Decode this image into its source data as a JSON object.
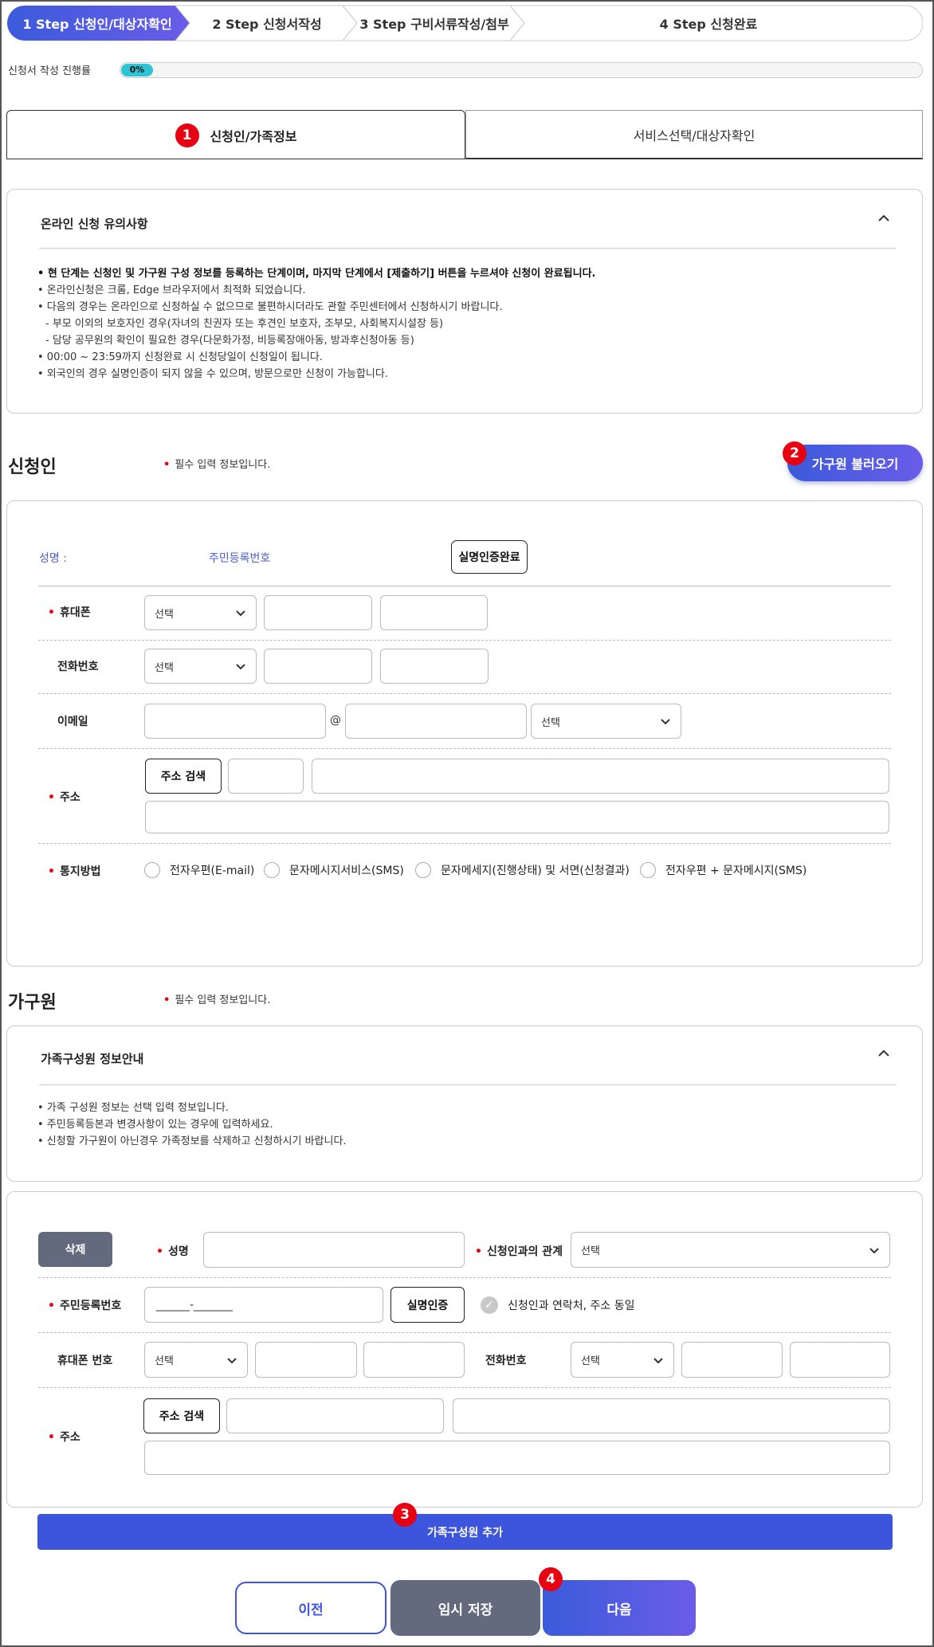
{
  "steps": [
    {
      "label": "1 Step 신청인/대상자확인",
      "active": true
    },
    {
      "label": "2 Step 신청서작성",
      "active": false
    },
    {
      "label": "3 Step 구비서류작성/첨부",
      "active": false
    },
    {
      "label": "4 Step 신청완료",
      "active": false
    }
  ],
  "progress": {
    "label": "신청서 작성 진행률",
    "value_text": "0%",
    "percent": 0
  },
  "tabs": {
    "active": "신청인/가족정보",
    "inactive": "서비스선택/대상자확인"
  },
  "badges": {
    "one": "1",
    "two": "2",
    "three": "3",
    "four": "4"
  },
  "notice": {
    "title": "온라인 신청 유의사항",
    "items": [
      "• 현 단계는 신청인 및 가구원 구성 정보를 등록하는 단계이며, 마지막 단계에서 [제출하기] 버튼을 누르셔야 신청이 완료됩니다.",
      "• 온라인신청은 크롬, Edge 브라우저에서 최적화 되었습니다.",
      "• 다음의 경우는 온라인으로 신청하실 수 없으므로 불편하시더라도 관할 주민센터에서 신청하시기 바랍니다.",
      "  - 부모 이외의 보호자인 경우(자녀의 친권자 또는 후견인 보호자, 조부모, 사회복지시설장 등)",
      "  - 담당 공무원의 확인이 필요한 경우(다문화가정, 비등록장애아동, 방과후신청아동 등)",
      "• 00:00 ~ 23:59까지 신청완료 시 신청당일이 신청일이 됩니다.",
      "• 외국인의 경우 실명인증이 되지 않을 수 있으며, 방문으로만 신청이 가능합니다."
    ]
  },
  "applicant": {
    "title": "신청인",
    "required_note": "필수 입력 정보입니다.",
    "load_family_button": "가구원 불러오기",
    "name_label": "성명 :",
    "rrn_label": "주민등록번호",
    "verified_button": "실명인증완료",
    "mobile_label": "휴대폰",
    "phone_label": "전화번호",
    "email_label": "이메일",
    "at_sign": "@",
    "address_label": "주소",
    "address_search": "주소 검색",
    "notify_label": "통지방법",
    "select_placeholder": "선택",
    "notify_options": [
      "전자우편(E-mail)",
      "문자메시지서비스(SMS)",
      "문자메세지(진행상태) 및 서면(신청결과)",
      "전자우편 + 문자메시지(SMS)"
    ]
  },
  "household": {
    "title": "가구원",
    "required_note": "필수 입력 정보입니다.",
    "info_title": "가족구성원 정보안내",
    "info_items": [
      "• 가족 구성원 정보는 선택 입력 정보입니다.",
      "• 주민등록등본과 변경사항이 있는 경우에 입력하세요.",
      "• 신청할 가구원이 아닌경우 가족정보를 삭제하고 신청하시기 바랍니다."
    ],
    "delete_button": "삭제",
    "name_label": "성명",
    "relation_label": "신청인과의 관계",
    "rrn_label": "주민등록번호",
    "rrn_value": "______-_______",
    "verify_button": "실명인증",
    "same_contact": "신청인과 연락처, 주소 동일",
    "mobile_label": "휴대폰 번호",
    "phone_label": "전화번호",
    "address_label": "주소",
    "address_search": "주소 검색",
    "select_placeholder": "선택",
    "add_button": "가족구성원 추가"
  },
  "footer": {
    "prev": "이전",
    "save": "임시 저장",
    "next": "다음"
  },
  "colors": {
    "accent": "#3d55dc",
    "accent2": "#6a5ce8",
    "required": "#e60012",
    "progress": "#2ec4d6",
    "gray_button": "#636a7e"
  }
}
